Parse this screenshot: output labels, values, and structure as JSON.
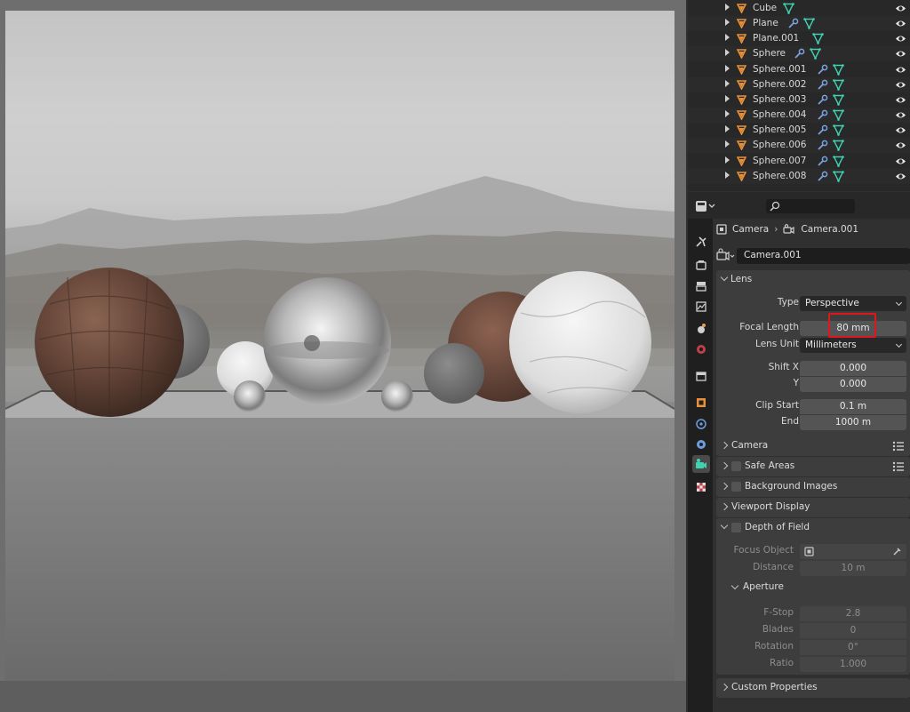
{
  "outliner": {
    "items": [
      {
        "name": "Cube",
        "modifier": false
      },
      {
        "name": "Plane",
        "modifier": true
      },
      {
        "name": "Plane.001",
        "modifier": false
      },
      {
        "name": "Sphere",
        "modifier": true
      },
      {
        "name": "Sphere.001",
        "modifier": true
      },
      {
        "name": "Sphere.002",
        "modifier": true
      },
      {
        "name": "Sphere.003",
        "modifier": true
      },
      {
        "name": "Sphere.004",
        "modifier": true
      },
      {
        "name": "Sphere.005",
        "modifier": true
      },
      {
        "name": "Sphere.006",
        "modifier": true
      },
      {
        "name": "Sphere.007",
        "modifier": true
      },
      {
        "name": "Sphere.008",
        "modifier": true
      }
    ]
  },
  "properties": {
    "breadcrumb": {
      "object": "Camera",
      "data": "Camera.001"
    },
    "data_block": "Camera.001",
    "lens": {
      "title": "Lens",
      "type_label": "Type",
      "type_value": "Perspective",
      "focal_label": "Focal Length",
      "focal_value": "80 mm",
      "unit_label": "Lens Unit",
      "unit_value": "Millimeters",
      "shift_x_label": "Shift X",
      "shift_x_value": "0.000",
      "shift_y_label": "Y",
      "shift_y_value": "0.000",
      "clip_start_label": "Clip Start",
      "clip_start_value": "0.1 m",
      "clip_end_label": "End",
      "clip_end_value": "1000 m"
    },
    "panels": {
      "camera": "Camera",
      "safe_areas": "Safe Areas",
      "background_images": "Background Images",
      "viewport_display": "Viewport Display",
      "depth_of_field": "Depth of Field",
      "custom_properties": "Custom Properties"
    },
    "dof": {
      "focus_object_label": "Focus Object",
      "distance_label": "Distance",
      "distance_value": "10 m",
      "aperture_title": "Aperture",
      "fstop_label": "F-Stop",
      "fstop_value": "2.8",
      "blades_label": "Blades",
      "blades_value": "0",
      "rotation_label": "Rotation",
      "rotation_value": "0°",
      "ratio_label": "Ratio",
      "ratio_value": "1.000"
    }
  },
  "colors": {
    "object_icon": "#e8913a",
    "mesh_icon": "#3fd2b0",
    "modifier_icon": "#7aa2e0",
    "highlight": "#e0161c"
  }
}
